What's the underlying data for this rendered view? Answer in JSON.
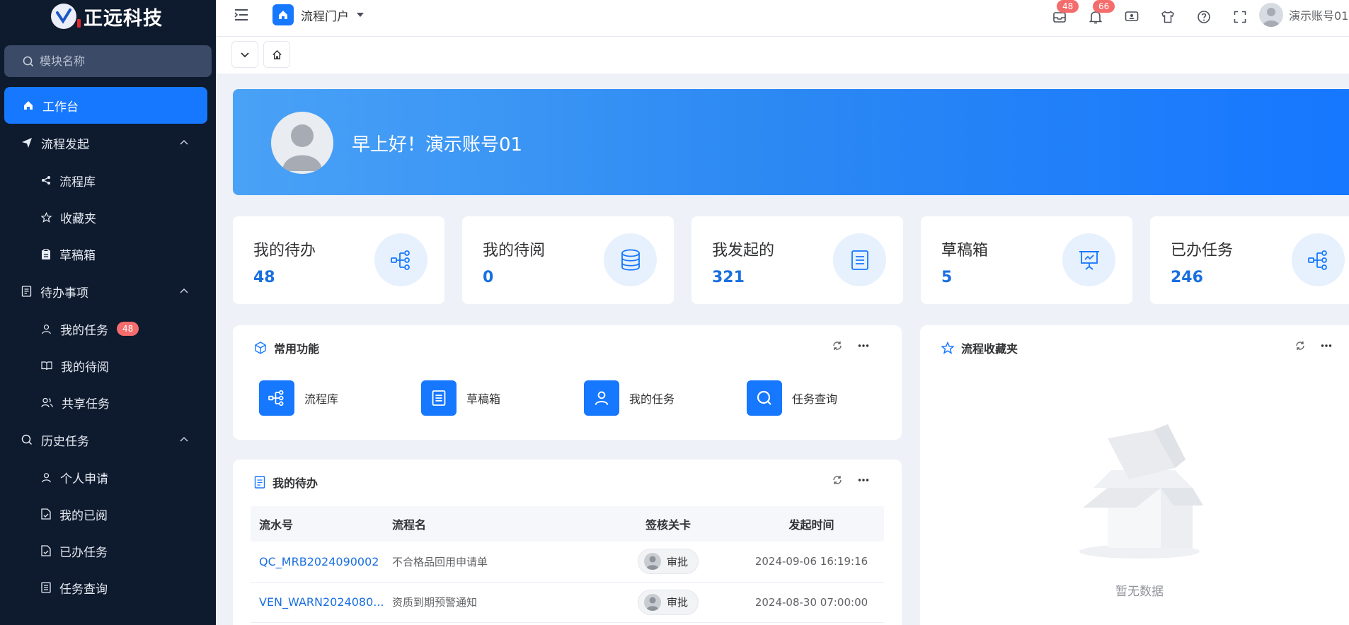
{
  "sidebar": {
    "logo_text": "正远科技",
    "search_placeholder": "模块名称",
    "items": [
      {
        "label": "工作台"
      },
      {
        "label": "流程发起"
      },
      {
        "label": "流程库"
      },
      {
        "label": "收藏夹"
      },
      {
        "label": "草稿箱"
      },
      {
        "label": "待办事项"
      },
      {
        "label": "我的任务",
        "badge": "48"
      },
      {
        "label": "我的待阅"
      },
      {
        "label": "共享任务"
      },
      {
        "label": "历史任务"
      },
      {
        "label": "个人申请"
      },
      {
        "label": "我的已阅"
      },
      {
        "label": "已办任务"
      },
      {
        "label": "任务查询"
      }
    ]
  },
  "header": {
    "portal_label": "流程门户",
    "badge_messages": "48",
    "badge_notifications": "66",
    "user_name": "演示账号01"
  },
  "banner": {
    "greeting": "早上好！演示账号01"
  },
  "stats": [
    {
      "label": "我的待办",
      "value": "48"
    },
    {
      "label": "我的待阅",
      "value": "0"
    },
    {
      "label": "我发起的",
      "value": "321"
    },
    {
      "label": "草稿箱",
      "value": "5"
    },
    {
      "label": "已办任务",
      "value": "246"
    }
  ],
  "common": {
    "title": "常用功能",
    "items": [
      {
        "label": "流程库"
      },
      {
        "label": "草稿箱"
      },
      {
        "label": "我的任务"
      },
      {
        "label": "任务查询"
      }
    ]
  },
  "todo": {
    "title": "我的待办",
    "columns": [
      "流水号",
      "流程名",
      "签核关卡",
      "发起时间"
    ],
    "rows": [
      {
        "serial": "QC_MRB2024090002",
        "name": "不合格品回用申请单",
        "stage": "审批",
        "time": "2024-09-06 16:19:16"
      },
      {
        "serial": "VEN_WARN2024080...",
        "name": "资质到期预警通知",
        "stage": "审批",
        "time": "2024-08-30 07:00:00"
      }
    ]
  },
  "favorites": {
    "title": "流程收藏夹",
    "empty_text": "暂无数据"
  },
  "colors": {
    "primary": "#1677ff",
    "sidebar_bg": "#0e1a2d",
    "badge": "#f56c6c"
  }
}
